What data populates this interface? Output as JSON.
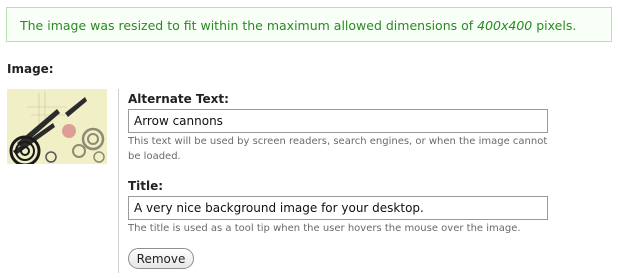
{
  "status": {
    "message_before": "The image was resized to fit within the maximum allowed dimensions of ",
    "dimensions": "400x400",
    "message_after": " pixels."
  },
  "image_section": {
    "heading": "Image:",
    "thumbnail_icon": "image-thumbnail"
  },
  "alt_text": {
    "label": "Alternate Text:",
    "value": "Arrow cannons",
    "description_line1": "This text will be used by screen readers, search engines, or when the image cannot",
    "description_line2": "be loaded."
  },
  "title_field": {
    "label": "Title:",
    "value": "A very nice background image for your desktop.",
    "description": "The title is used as a tool tip when the user hovers the mouse over the image."
  },
  "remove_button": {
    "label": "Remove"
  },
  "colors": {
    "success_text": "#2a8a22",
    "success_border": "#b9e0b4",
    "thumb_bg": "#f1efc6"
  }
}
